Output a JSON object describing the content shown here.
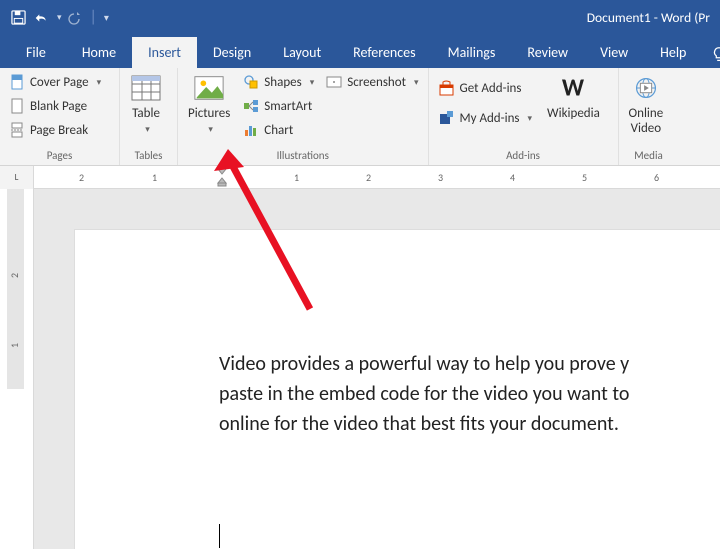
{
  "titlebar": {
    "doc_title": "Document1 - Word (Pr"
  },
  "tabs": {
    "file": "File",
    "home": "Home",
    "insert": "Insert",
    "design": "Design",
    "layout": "Layout",
    "references": "References",
    "mailings": "Mailings",
    "review": "Review",
    "view": "View",
    "help": "Help"
  },
  "ribbon": {
    "pages": {
      "label": "Pages",
      "cover_page": "Cover Page",
      "blank_page": "Blank Page",
      "page_break": "Page Break"
    },
    "tables": {
      "label": "Tables",
      "table": "Table"
    },
    "illustrations": {
      "label": "Illustrations",
      "pictures": "Pictures",
      "shapes": "Shapes",
      "smartart": "SmartArt",
      "chart": "Chart",
      "screenshot": "Screenshot"
    },
    "addins": {
      "label": "Add-ins",
      "get_addins": "Get Add-ins",
      "my_addins": "My Add-ins",
      "wikipedia": "Wikipedia"
    },
    "media": {
      "label": "Media",
      "online_video": "Online\nVideo"
    }
  },
  "ruler": {
    "h_numbers": [
      "2",
      "1",
      "1",
      "2",
      "3",
      "4",
      "5",
      "6"
    ],
    "v_numbers": [
      "2",
      "1"
    ]
  },
  "document": {
    "line1": "Video provides a powerful way to help you prove y",
    "line2": "paste in the embed code for the video you want to",
    "line3": "online for the video that best fits your document."
  }
}
